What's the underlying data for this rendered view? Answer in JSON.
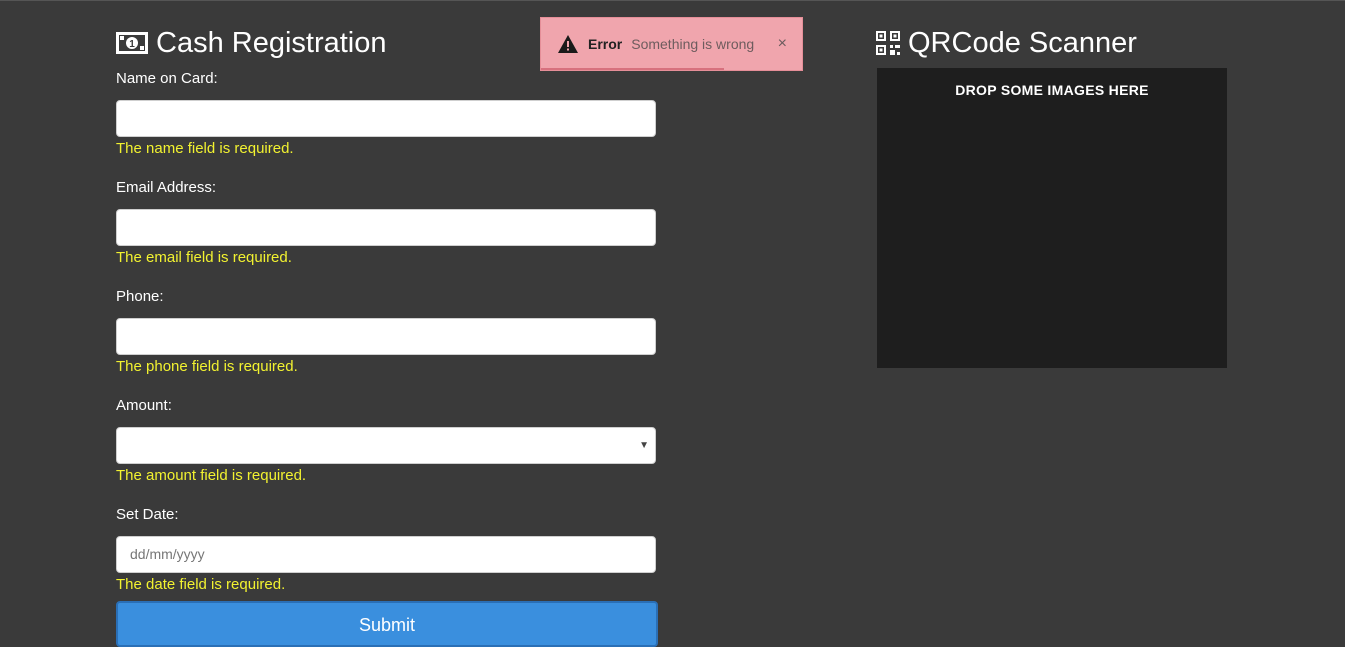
{
  "cash_registration": {
    "title": "Cash Registration",
    "icon": "money-bill-icon",
    "fields": {
      "name": {
        "label": "Name on Card:",
        "value": "",
        "error": "The name field is required."
      },
      "email": {
        "label": "Email Address:",
        "value": "",
        "error": "The email field is required."
      },
      "phone": {
        "label": "Phone:",
        "value": "",
        "error": "The phone field is required."
      },
      "amount": {
        "label": "Amount:",
        "selected": "",
        "error": "The amount field is required."
      },
      "date": {
        "label": "Set Date:",
        "placeholder": "dd/mm/yyyy",
        "error": "The date field is required."
      }
    },
    "submit_label": "Submit"
  },
  "toast": {
    "icon": "warning-icon",
    "title": "Error",
    "message": "Something is wrong",
    "close": "×",
    "progress_fraction": 0.7
  },
  "qr_scanner": {
    "title": "QRCode Scanner",
    "icon": "qrcode-icon",
    "drop_text": "DROP SOME IMAGES HERE"
  },
  "colors": {
    "background": "#3a3a3a",
    "error_text": "#f2f230",
    "submit": "#3a8fde",
    "toast": "#f0a5ad",
    "drop_zone": "#1e1e1e"
  }
}
